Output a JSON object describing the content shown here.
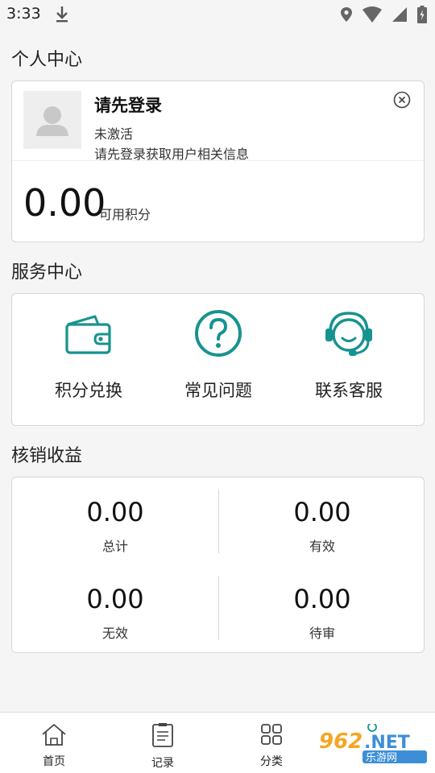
{
  "status_bar": {
    "time": "3:33",
    "icons": [
      "download-icon",
      "location-icon",
      "wifi-icon",
      "signal-icon",
      "battery-icon"
    ]
  },
  "profile": {
    "section_title": "个人中心",
    "login_title": "请先登录",
    "login_status": "未激活",
    "login_desc": "请先登录获取用户相关信息",
    "points_value": "0.00",
    "points_label": "可用积分"
  },
  "services": {
    "section_title": "服务中心",
    "items": [
      {
        "label": "积分兑换",
        "icon": "wallet-icon"
      },
      {
        "label": "常见问题",
        "icon": "question-icon"
      },
      {
        "label": "联系客服",
        "icon": "headset-icon"
      }
    ],
    "accent": "#17938f"
  },
  "earnings": {
    "section_title": "核销收益",
    "stats": [
      {
        "value": "0.00",
        "label": "总计"
      },
      {
        "value": "0.00",
        "label": "有效"
      },
      {
        "value": "0.00",
        "label": "无效"
      },
      {
        "value": "0.00",
        "label": "待审"
      }
    ]
  },
  "bottom_nav": {
    "items": [
      {
        "label": "首页",
        "icon": "home-icon"
      },
      {
        "label": "记录",
        "icon": "clipboard-icon"
      },
      {
        "label": "分类",
        "icon": "grid-icon"
      }
    ],
    "watermark": "962.NET 乐游网"
  }
}
